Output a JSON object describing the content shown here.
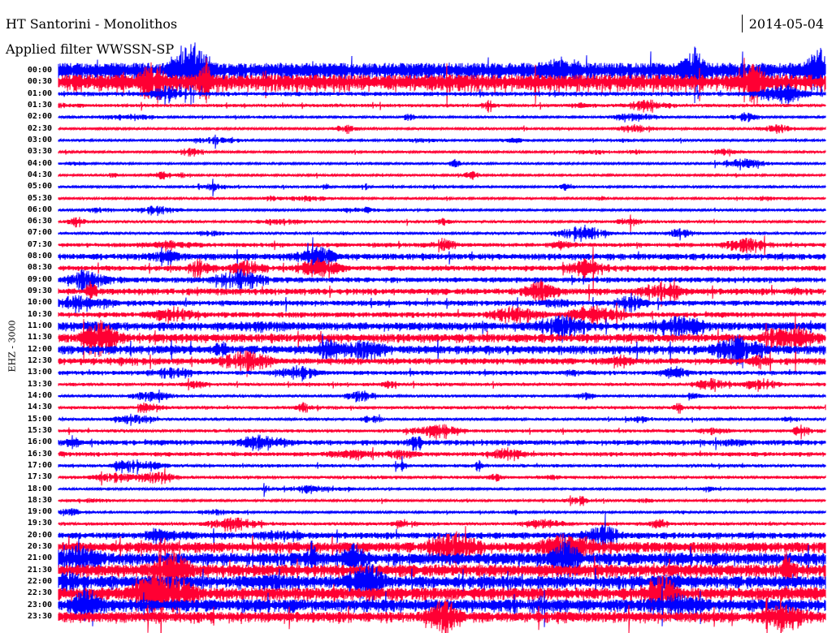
{
  "header": {
    "title": "HT Santorini - Monolithos",
    "filter": "Applied filter WWSSN-SP",
    "date": "2014-05-04"
  },
  "chart_data": {
    "type": "line",
    "title": "HT Santorini - Monolithos",
    "subtitle": "Applied filter WWSSN-SP",
    "date": "2014-05-04",
    "ylabel": "EHZ - 3000",
    "row_colors": [
      "#0000ff",
      "#ff0033"
    ],
    "row_labels": [
      "00:00",
      "00:30",
      "01:00",
      "01:30",
      "02:00",
      "02:30",
      "03:00",
      "03:30",
      "04:00",
      "04:30",
      "05:00",
      "05:30",
      "06:00",
      "06:30",
      "07:00",
      "07:30",
      "08:00",
      "08:30",
      "09:00",
      "09:30",
      "10:00",
      "10:30",
      "11:00",
      "11:30",
      "12:00",
      "12:30",
      "13:00",
      "13:30",
      "14:00",
      "14:30",
      "15:00",
      "15:30",
      "16:00",
      "16:30",
      "17:00",
      "17:30",
      "18:00",
      "18:30",
      "19:00",
      "19:30",
      "20:00",
      "20:30",
      "21:00",
      "21:30",
      "22:00",
      "22:30",
      "23:00",
      "23:30"
    ],
    "relative_noise_level": [
      8,
      8,
      2,
      1.5,
      1,
      1,
      1,
      1,
      1,
      1,
      1,
      1,
      1,
      1.2,
      1.2,
      2,
      3,
      2.5,
      2.5,
      3,
      2.5,
      2.5,
      4,
      4,
      4,
      3,
      2,
      1.5,
      1.2,
      1.5,
      1.2,
      1.5,
      2.5,
      2,
      1.5,
      1.5,
      1,
      1,
      1,
      1.5,
      3,
      5,
      6,
      6,
      6,
      6,
      6,
      5
    ]
  }
}
